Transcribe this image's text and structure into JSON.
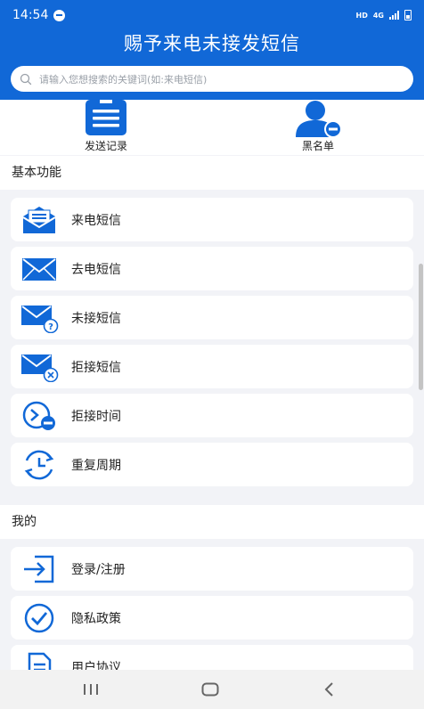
{
  "status_bar": {
    "time": "14:54",
    "network_label": "HD",
    "signal_label": "4G"
  },
  "header": {
    "title": "赐予来电未接发短信"
  },
  "search": {
    "placeholder": "请输入您想搜索的关键词(如:来电短信)"
  },
  "quick_actions": [
    {
      "label": "发送记录",
      "icon": "document-list-icon"
    },
    {
      "label": "黑名单",
      "icon": "user-block-icon"
    }
  ],
  "sections": {
    "basic": {
      "title": "基本功能",
      "items": [
        {
          "label": "来电短信",
          "icon": "open-envelope-icon"
        },
        {
          "label": "去电短信",
          "icon": "envelope-icon"
        },
        {
          "label": "未接短信",
          "icon": "envelope-question-icon"
        },
        {
          "label": "拒接短信",
          "icon": "envelope-x-icon"
        },
        {
          "label": "拒接时间",
          "icon": "clock-minus-icon"
        },
        {
          "label": "重复周期",
          "icon": "clock-repeat-icon"
        }
      ]
    },
    "mine": {
      "title": "我的",
      "items": [
        {
          "label": "登录/注册",
          "icon": "login-icon"
        },
        {
          "label": "隐私政策",
          "icon": "check-circle-icon"
        },
        {
          "label": "用户协议",
          "icon": "document-icon"
        }
      ]
    }
  },
  "colors": {
    "primary": "#1168d7",
    "background": "#f2f3f7",
    "card": "#ffffff"
  },
  "nav_bar": {
    "recent": "recent-apps-icon",
    "home": "home-icon",
    "back": "back-icon"
  }
}
